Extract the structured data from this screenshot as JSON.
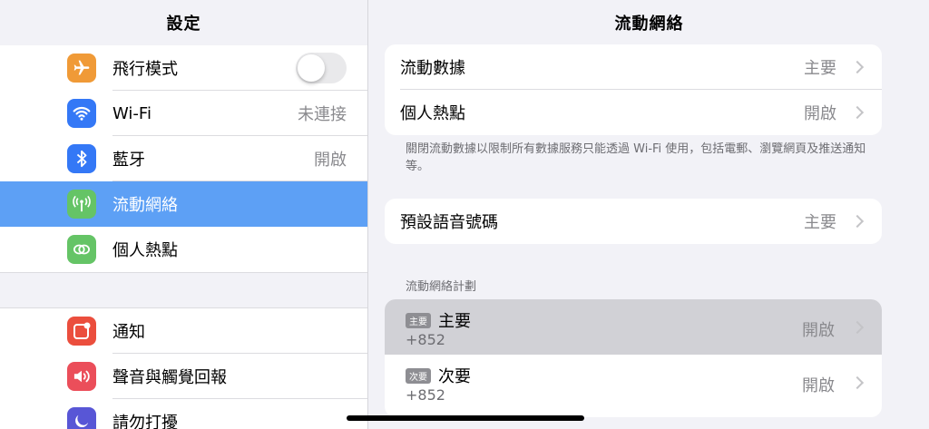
{
  "sidebar": {
    "title": "設定",
    "group1": [
      {
        "label": "飛行模式",
        "icon": "airplane-icon",
        "color": "#f09a37",
        "toggle": false
      },
      {
        "label": "Wi-Fi",
        "icon": "wifi-icon",
        "color": "#3478f6",
        "value": "未連接"
      },
      {
        "label": "藍牙",
        "icon": "bluetooth-icon",
        "color": "#3478f6",
        "value": "開啟"
      },
      {
        "label": "流動網絡",
        "icon": "antenna-icon",
        "color": "#65c466",
        "selected": true
      },
      {
        "label": "個人熱點",
        "icon": "hotspot-icon",
        "color": "#65c466"
      }
    ],
    "group2": [
      {
        "label": "通知",
        "icon": "notification-icon",
        "color": "#eb4e3d"
      },
      {
        "label": "聲音與觸覺回報",
        "icon": "sound-icon",
        "color": "#eb4e5a"
      },
      {
        "label": "請勿打擾",
        "icon": "moon-icon",
        "color": "#5856d6"
      }
    ]
  },
  "detail": {
    "title": "流動網絡",
    "card1": [
      {
        "label": "流動數據",
        "value": "主要"
      },
      {
        "label": "個人熱點",
        "value": "開啟"
      }
    ],
    "footnote": "關閉流動數據以限制所有數據服務只能透過 Wi-Fi 使用，包括電郵、瀏覽網頁及推送通知等。",
    "card2": [
      {
        "label": "預設語音號碼",
        "value": "主要"
      }
    ],
    "plans_header": "流動網絡計劃",
    "plans": [
      {
        "tag": "主要",
        "name": "主要",
        "number": "+852",
        "value": "開啟",
        "highlighted": true
      },
      {
        "tag": "次要",
        "name": "次要",
        "number": "+852",
        "value": "開啟",
        "highlighted": false
      }
    ]
  }
}
